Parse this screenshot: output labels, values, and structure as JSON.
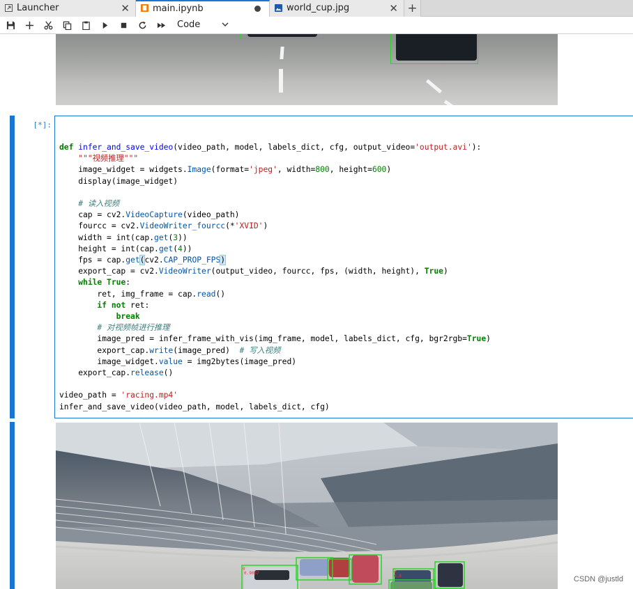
{
  "tabs": [
    {
      "label": "Launcher",
      "icon": "launcher-icon",
      "active": false
    },
    {
      "label": "main.ipynb",
      "icon": "notebook-icon",
      "active": true,
      "unsaved": true
    },
    {
      "label": "world_cup.jpg",
      "icon": "image-file-icon",
      "active": false
    }
  ],
  "toolbar": {
    "buttons": [
      "save-icon",
      "add-cell-icon",
      "cut-icon",
      "copy-icon",
      "paste-icon",
      "run-icon",
      "stop-icon",
      "restart-icon",
      "fast-forward-icon"
    ],
    "cell_type": "Code"
  },
  "cell": {
    "prompt": "[*]:",
    "code_lines": [
      "",
      "",
      "def infer_and_save_video(video_path, model, labels_dict, cfg, output_video='output.avi'):",
      "    \"\"\"视频推理\"\"\"",
      "    image_widget = widgets.Image(format='jpeg', width=800, height=600)",
      "    display(image_widget)",
      "",
      "    # 读入视频",
      "    cap = cv2.VideoCapture(video_path)",
      "    fourcc = cv2.VideoWriter_fourcc(*'XVID')",
      "    width = int(cap.get(3))",
      "    height = int(cap.get(4))",
      "    fps = cap.get(cv2.CAP_PROP_FPS)",
      "    export_cap = cv2.VideoWriter(output_video, fourcc, fps, (width, height), True)",
      "    while True:",
      "        ret, img_frame = cap.read()",
      "        if not ret:",
      "            break",
      "        # 对视频帧进行推理",
      "        image_pred = infer_frame_with_vis(img_frame, model, labels_dict, cfg, bgr2rgb=True)",
      "        export_cap.write(image_pred)  # 写入视频",
      "        image_widget.value = img2bytes(image_pred)",
      "    export_cap.release()",
      "",
      "video_path = 'racing.mp4'",
      "infer_and_save_video(video_path, model, labels_dict, cfg)"
    ]
  },
  "watermark": "CSDN @justld",
  "colors": {
    "accent": "#1976d2",
    "bbox": "#2dd22d"
  }
}
